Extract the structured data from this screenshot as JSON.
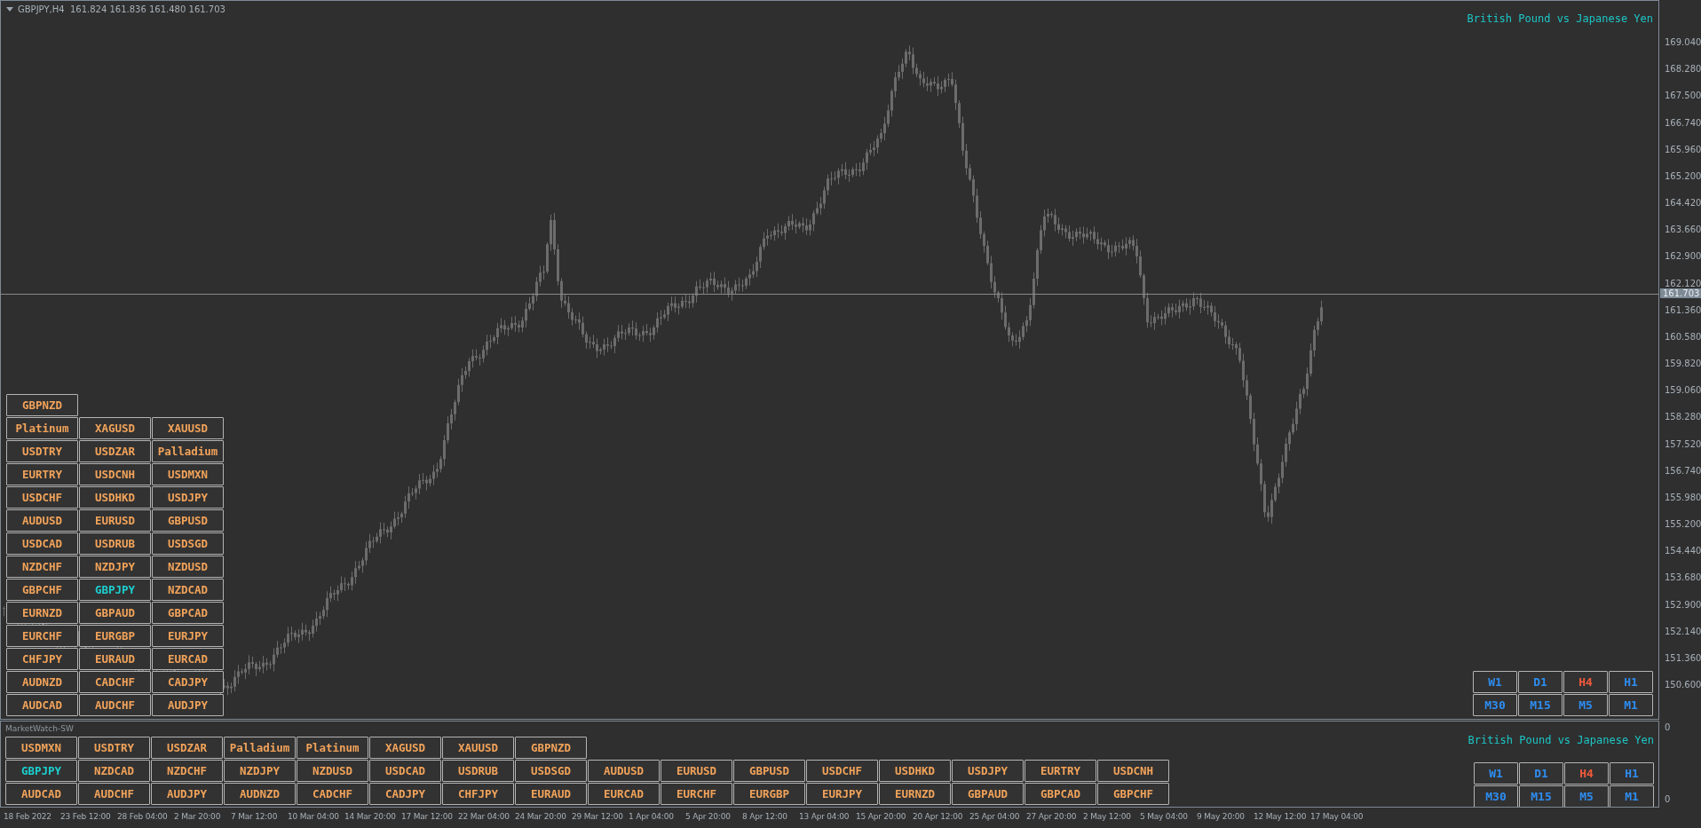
{
  "chart": {
    "symbol_info": "GBPJPY,H4  161.824 161.836 161.480 161.703",
    "title": "British Pound vs Japanese Yen",
    "current_price": "161.703",
    "price_ticks": [
      "169.040",
      "168.280",
      "167.500",
      "166.740",
      "165.960",
      "165.200",
      "164.420",
      "163.660",
      "162.900",
      "162.120",
      "161.360",
      "160.580",
      "159.820",
      "159.060",
      "158.280",
      "157.520",
      "156.740",
      "155.980",
      "155.200",
      "154.440",
      "153.680",
      "152.900",
      "152.140",
      "151.360",
      "150.600"
    ],
    "symbol_buttons": [
      [
        {
          "label": "GBPNZD",
          "selected": false
        }
      ],
      [
        {
          "label": "Platinum",
          "selected": false
        },
        {
          "label": "XAGUSD",
          "selected": false
        },
        {
          "label": "XAUUSD",
          "selected": false
        }
      ],
      [
        {
          "label": "USDTRY",
          "selected": false
        },
        {
          "label": "USDZAR",
          "selected": false
        },
        {
          "label": "Palladium",
          "selected": false
        }
      ],
      [
        {
          "label": "EURTRY",
          "selected": false
        },
        {
          "label": "USDCNH",
          "selected": false
        },
        {
          "label": "USDMXN",
          "selected": false
        }
      ],
      [
        {
          "label": "USDCHF",
          "selected": false
        },
        {
          "label": "USDHKD",
          "selected": false
        },
        {
          "label": "USDJPY",
          "selected": false
        }
      ],
      [
        {
          "label": "AUDUSD",
          "selected": false
        },
        {
          "label": "EURUSD",
          "selected": false
        },
        {
          "label": "GBPUSD",
          "selected": false
        }
      ],
      [
        {
          "label": "USDCAD",
          "selected": false
        },
        {
          "label": "USDRUB",
          "selected": false
        },
        {
          "label": "USDSGD",
          "selected": false
        }
      ],
      [
        {
          "label": "NZDCHF",
          "selected": false
        },
        {
          "label": "NZDJPY",
          "selected": false
        },
        {
          "label": "NZDUSD",
          "selected": false
        }
      ],
      [
        {
          "label": "GBPCHF",
          "selected": false
        },
        {
          "label": "GBPJPY",
          "selected": true
        },
        {
          "label": "NZDCAD",
          "selected": false
        }
      ],
      [
        {
          "label": "EURNZD",
          "selected": false
        },
        {
          "label": "GBPAUD",
          "selected": false
        },
        {
          "label": "GBPCAD",
          "selected": false
        }
      ],
      [
        {
          "label": "EURCHF",
          "selected": false
        },
        {
          "label": "EURGBP",
          "selected": false
        },
        {
          "label": "EURJPY",
          "selected": false
        }
      ],
      [
        {
          "label": "CHFJPY",
          "selected": false
        },
        {
          "label": "EURAUD",
          "selected": false
        },
        {
          "label": "EURCAD",
          "selected": false
        }
      ],
      [
        {
          "label": "AUDNZD",
          "selected": false
        },
        {
          "label": "CADCHF",
          "selected": false
        },
        {
          "label": "CADJPY",
          "selected": false
        }
      ],
      [
        {
          "label": "AUDCAD",
          "selected": false
        },
        {
          "label": "AUDCHF",
          "selected": false
        },
        {
          "label": "AUDJPY",
          "selected": false
        }
      ]
    ],
    "timeframes": [
      {
        "label": "W1",
        "selected": false
      },
      {
        "label": "D1",
        "selected": false
      },
      {
        "label": "H4",
        "selected": true
      },
      {
        "label": "H1",
        "selected": false
      },
      {
        "label": "M30",
        "selected": false
      },
      {
        "label": "M15",
        "selected": false
      },
      {
        "label": "M5",
        "selected": false
      },
      {
        "label": "M1",
        "selected": false
      }
    ]
  },
  "subwindow": {
    "name": "MarketWatch-SW",
    "title": "British Pound vs Japanese Yen",
    "axis_labels": [
      "0",
      "0"
    ],
    "symbol_buttons": [
      [
        {
          "label": "USDMXN",
          "selected": false
        },
        {
          "label": "USDTRY",
          "selected": false
        },
        {
          "label": "USDZAR",
          "selected": false
        },
        {
          "label": "Palladium",
          "selected": false
        },
        {
          "label": "Platinum",
          "selected": false
        },
        {
          "label": "XAGUSD",
          "selected": false
        },
        {
          "label": "XAUUSD",
          "selected": false
        },
        {
          "label": "GBPNZD",
          "selected": false
        }
      ],
      [
        {
          "label": "GBPJPY",
          "selected": true
        },
        {
          "label": "NZDCAD",
          "selected": false
        },
        {
          "label": "NZDCHF",
          "selected": false
        },
        {
          "label": "NZDJPY",
          "selected": false
        },
        {
          "label": "NZDUSD",
          "selected": false
        },
        {
          "label": "USDCAD",
          "selected": false
        },
        {
          "label": "USDRUB",
          "selected": false
        },
        {
          "label": "USDSGD",
          "selected": false
        },
        {
          "label": "AUDUSD",
          "selected": false
        },
        {
          "label": "EURUSD",
          "selected": false
        },
        {
          "label": "GBPUSD",
          "selected": false
        },
        {
          "label": "USDCHF",
          "selected": false
        },
        {
          "label": "USDHKD",
          "selected": false
        },
        {
          "label": "USDJPY",
          "selected": false
        },
        {
          "label": "EURTRY",
          "selected": false
        },
        {
          "label": "USDCNH",
          "selected": false
        }
      ],
      [
        {
          "label": "AUDCAD",
          "selected": false
        },
        {
          "label": "AUDCHF",
          "selected": false
        },
        {
          "label": "AUDJPY",
          "selected": false
        },
        {
          "label": "AUDNZD",
          "selected": false
        },
        {
          "label": "CADCHF",
          "selected": false
        },
        {
          "label": "CADJPY",
          "selected": false
        },
        {
          "label": "CHFJPY",
          "selected": false
        },
        {
          "label": "EURAUD",
          "selected": false
        },
        {
          "label": "EURCAD",
          "selected": false
        },
        {
          "label": "EURCHF",
          "selected": false
        },
        {
          "label": "EURGBP",
          "selected": false
        },
        {
          "label": "EURJPY",
          "selected": false
        },
        {
          "label": "EURNZD",
          "selected": false
        },
        {
          "label": "GBPAUD",
          "selected": false
        },
        {
          "label": "GBPCAD",
          "selected": false
        },
        {
          "label": "GBPCHF",
          "selected": false
        }
      ]
    ],
    "timeframes": [
      {
        "label": "W1",
        "selected": false
      },
      {
        "label": "D1",
        "selected": false
      },
      {
        "label": "H4",
        "selected": true
      },
      {
        "label": "H1",
        "selected": false
      },
      {
        "label": "M30",
        "selected": false
      },
      {
        "label": "M15",
        "selected": false
      },
      {
        "label": "M5",
        "selected": false
      },
      {
        "label": "M1",
        "selected": false
      }
    ]
  },
  "time_axis": [
    "18 Feb 2022",
    "23 Feb 12:00",
    "28 Feb 04:00",
    "2 Mar 20:00",
    "7 Mar 12:00",
    "10 Mar 04:00",
    "14 Mar 20:00",
    "17 Mar 12:00",
    "22 Mar 04:00",
    "24 Mar 20:00",
    "29 Mar 12:00",
    "1 Apr 04:00",
    "5 Apr 20:00",
    "8 Apr 12:00",
    "13 Apr 04:00",
    "15 Apr 20:00",
    "20 Apr 12:00",
    "25 Apr 04:00",
    "27 Apr 20:00",
    "2 May 12:00",
    "5 May 04:00",
    "9 May 20:00",
    "12 May 12:00",
    "17 May 04:00"
  ]
}
